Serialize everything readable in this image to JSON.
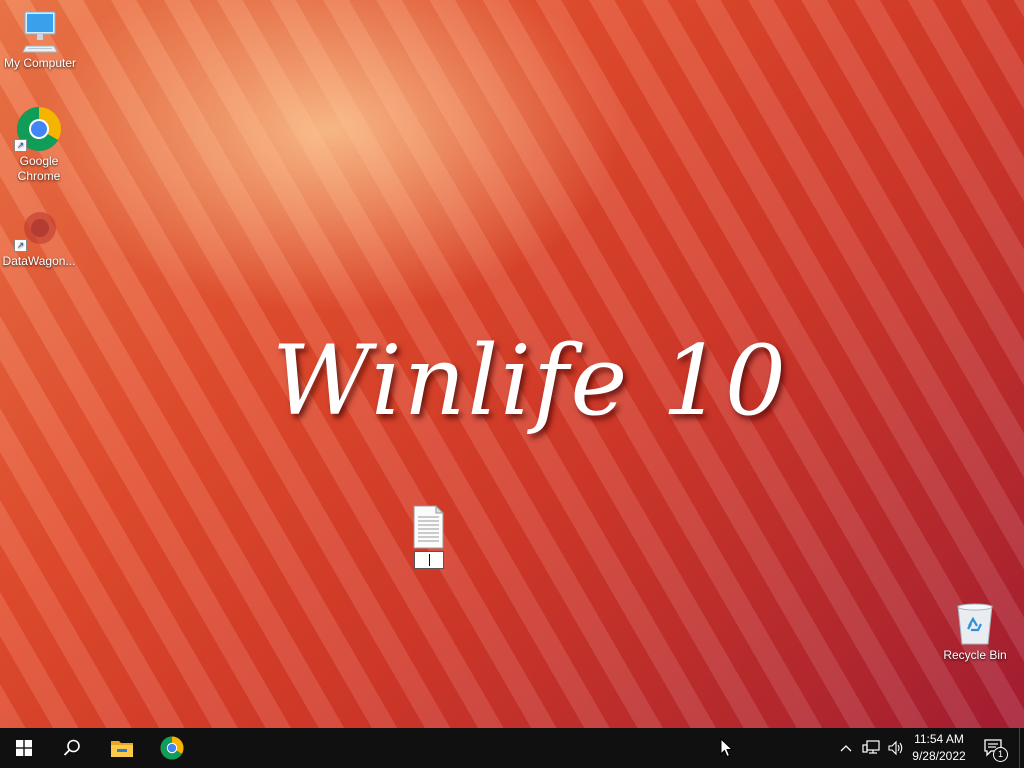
{
  "desktop": {
    "icons": [
      {
        "label": "My Computer",
        "icon": "my-computer-icon"
      },
      {
        "label": "Google\nChrome",
        "icon": "chrome-icon"
      },
      {
        "label": "DataWagon...",
        "icon": "datawagon-icon"
      },
      {
        "label": "Recycle Bin",
        "icon": "recycle-bin-icon"
      }
    ],
    "wallpaper_text": "Winlife 10",
    "renaming_file": {
      "icon": "text-file-icon",
      "value": ""
    }
  },
  "taskbar": {
    "start_icon": "windows-start-icon",
    "search_icon": "search-icon",
    "pinned": [
      "file-explorer-icon",
      "chrome-icon"
    ],
    "tray": [
      "chevron-up-icon",
      "network-icon",
      "volume-icon"
    ],
    "clock": {
      "time": "11:54 AM",
      "date": "9/28/2022"
    },
    "notifications": {
      "icon": "action-center-icon",
      "count": "1"
    }
  },
  "colors": {
    "taskbar": "#101010",
    "wallpaper_primary": "#e04a2e",
    "wallpaper_dark": "#a41e34"
  }
}
